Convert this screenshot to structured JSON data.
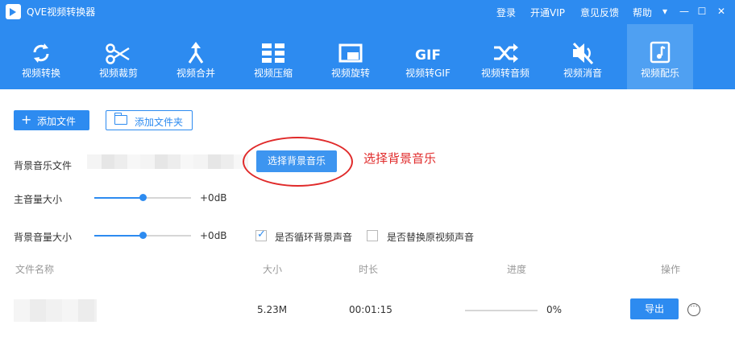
{
  "window": {
    "title": "QVE视频转换器",
    "links": [
      "登录",
      "开通VIP",
      "意见反馈",
      "帮助"
    ]
  },
  "toolbar": {
    "items": [
      {
        "label": "视频转换",
        "icon": "convert-icon"
      },
      {
        "label": "视频裁剪",
        "icon": "scissors-icon"
      },
      {
        "label": "视频合并",
        "icon": "merge-icon"
      },
      {
        "label": "视频压缩",
        "icon": "compress-icon"
      },
      {
        "label": "视频旋转",
        "icon": "rotate-icon"
      },
      {
        "label": "视频转GIF",
        "icon": "gif-icon",
        "glyph": "GIF"
      },
      {
        "label": "视频转音频",
        "icon": "shuffle-icon"
      },
      {
        "label": "视频消音",
        "icon": "mute-icon"
      },
      {
        "label": "视频配乐",
        "icon": "music-icon",
        "active": true
      }
    ],
    "accent": "#2d8bf0"
  },
  "actions": {
    "add_file": "添加文件",
    "add_folder": "添加文件夹"
  },
  "settings": {
    "bg_music_label": "背景音乐文件",
    "select_bg_music": "选择背景音乐",
    "annotation": "选择背景音乐",
    "main_volume_label": "主音量大小",
    "main_volume_value": "+0dB",
    "main_volume_level": 0.5,
    "bg_volume_label": "背景音量大小",
    "bg_volume_value": "+0dB",
    "bg_volume_level": 0.5,
    "loop_bg_label": "是否循环背景声音",
    "loop_bg_checked": true,
    "replace_audio_label": "是否替换原视频声音",
    "replace_audio_checked": false
  },
  "table": {
    "headers": {
      "name": "文件名称",
      "size": "大小",
      "duration": "时长",
      "progress": "进度",
      "action": "操作"
    },
    "rows": [
      {
        "size": "5.23M",
        "duration": "00:01:15",
        "progress_text": "0%",
        "progress": 0,
        "export_label": "导出"
      }
    ]
  }
}
